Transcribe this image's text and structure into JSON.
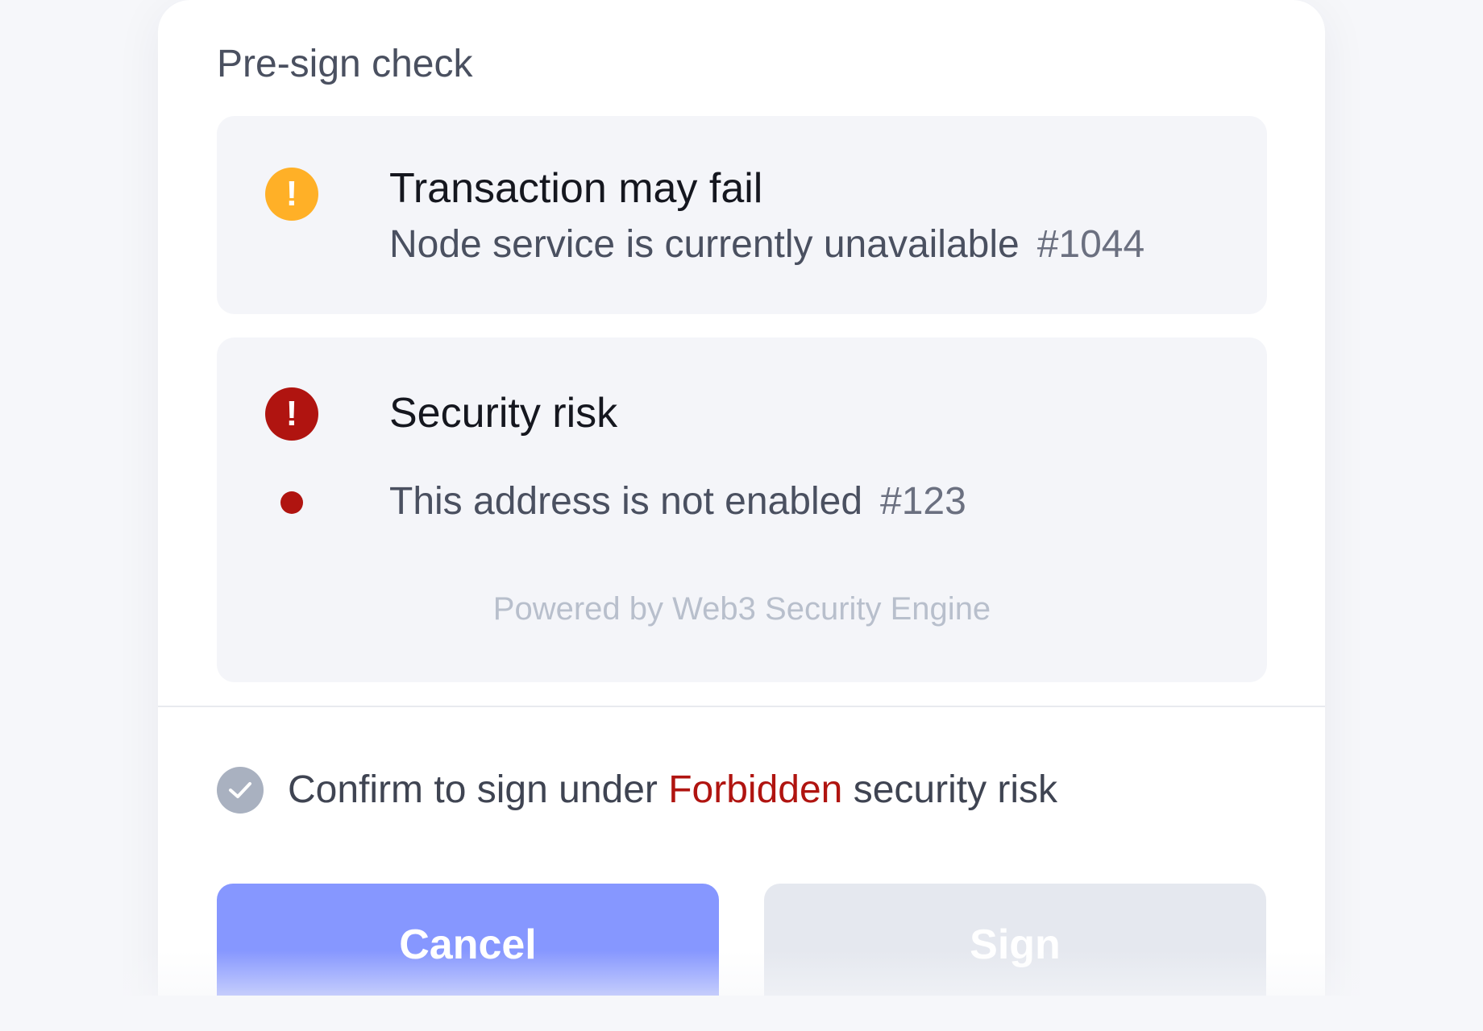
{
  "section_title": "Pre-sign check",
  "checks": [
    {
      "level": "warning",
      "icon": "exclamation-warning-icon",
      "color": "#ffb027",
      "title": "Transaction may fail",
      "description": "Node service is currently unavailable",
      "code": "#1044"
    },
    {
      "level": "danger",
      "icon": "exclamation-danger-icon",
      "color": "#b01410",
      "title": "Security risk",
      "description": "This address is not enabled",
      "code": "#123",
      "footer": "Powered by Web3 Security Engine"
    }
  ],
  "confirm": {
    "prefix": "Confirm to sign under ",
    "highlight": "Forbidden",
    "suffix": " security risk",
    "checked": false,
    "highlight_color": "#b01410"
  },
  "buttons": {
    "cancel_label": "Cancel",
    "sign_label": "Sign",
    "cancel_color": "#8697ff",
    "sign_color": "#e5e8ef"
  },
  "icons": {
    "exclamation": "!",
    "check": "check-icon"
  }
}
